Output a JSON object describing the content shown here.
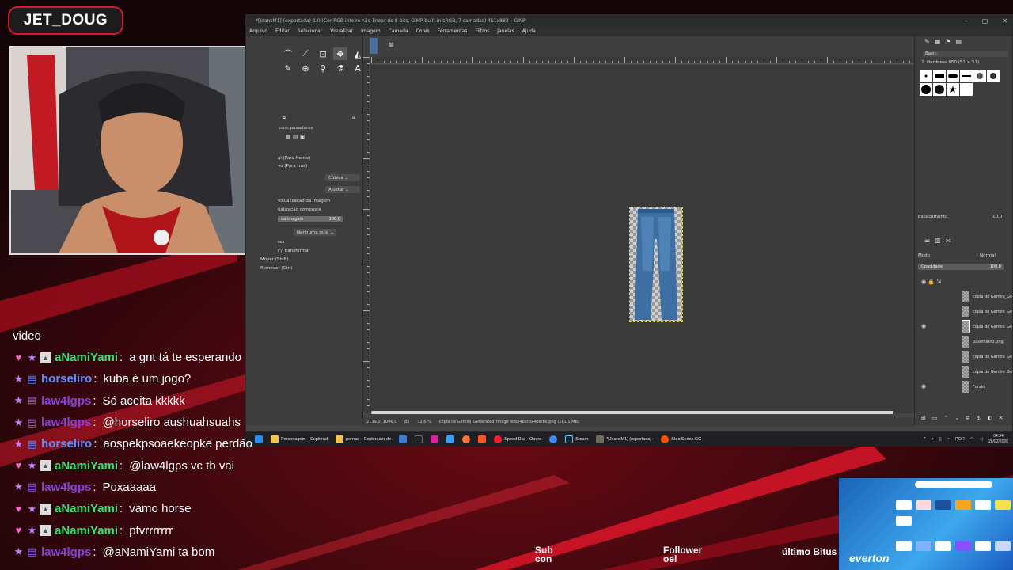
{
  "streamer": {
    "name": "JET_DOUG"
  },
  "gimp": {
    "title": "*[JeansM1] (exportada)-1.0 (Cor RGB inteiro não-linear de 8 bits, GIMP built-in sRGB, 7 camadas) 411x889 – GIMP",
    "menu": [
      "Arquivo",
      "Editar",
      "Selecionar",
      "Visualizar",
      "Imagem",
      "Camada",
      "Cores",
      "Ferramentas",
      "Filtros",
      "Janelas",
      "Ajuda"
    ],
    "tool_options": {
      "title": "com puxadores",
      "direction_1": "al (Para frente)",
      "direction_2": "vo (Para trás)",
      "interpolation": "Cúbica",
      "clipping": "Ajustar",
      "preview_1": "visualização da imagem",
      "preview_2": "ualização composta",
      "image_opacity_label": "da imagem",
      "image_opacity_value": "100,0",
      "guides": "Nenhuma guia",
      "guides_label": "res",
      "constraint": "r / Transformar",
      "move": "Mover (Shift)",
      "remove": "Remover (Ctrl)"
    },
    "status": {
      "coords": "2139,0, 1046,5",
      "unit": "px",
      "zoom": "32,6 %",
      "file": "cópia de Gemini_Generated_Image_erbx4berbx4berbx.png (161,1 MB)"
    },
    "brushes": {
      "preset": "Basic.",
      "brush_name": "2. Hardness 050 (51 × 51)",
      "spacing_label": "Espaçamento",
      "spacing_value": "10,0"
    },
    "layers_panel": {
      "mode_label": "Modo",
      "mode_value": "Normal",
      "opacity_label": "Opacidade",
      "opacity_value": "100,0",
      "layers": [
        "cópia de Gemini_Ge",
        "cópia de Gemini_Ge",
        "cópia de Gemini_Ge",
        "basemain3.png",
        "cópia de Gemini_Ge",
        "cópia de Gemini_Ge",
        "Fundo"
      ]
    }
  },
  "taskbar": {
    "items": [
      "Personagem – Explorad",
      "pernas – Explorador de",
      "Speed Dial - Opera",
      "Steam",
      "*[JeansM1] (exportada)-",
      "SteelSeries GG"
    ],
    "lang": "POR",
    "time": "04:34",
    "date": "28/02/2026"
  },
  "chat": {
    "header": "video",
    "messages": [
      {
        "user": "aNamiYami",
        "text": "a gnt tá te esperando",
        "color": "#39e070"
      },
      {
        "user": "horseliro",
        "text": "kuba é um jogo?",
        "color": "#5b8cff"
      },
      {
        "user": "law4lgps",
        "text": "Só aceita kkkkk",
        "color": "#8a3fd8"
      },
      {
        "user": "law4lgps",
        "text": "@horseliro aushuahsuahs",
        "color": "#8a3fd8"
      },
      {
        "user": "horseliro",
        "text": "aospekpsoaekeopke perdão",
        "color": "#5b8cff"
      },
      {
        "user": "aNamiYami",
        "text": "@law4lgps vc tb vai",
        "color": "#39e070"
      },
      {
        "user": "law4lgps",
        "text": "Poxaaaaa",
        "color": "#8a3fd8"
      },
      {
        "user": "aNamiYami",
        "text": "vamo horse",
        "color": "#39e070"
      },
      {
        "user": "aNamiYami",
        "text": "pfvrrrrrrr",
        "color": "#39e070"
      },
      {
        "user": "law4lgps",
        "text": "@aNamiYami ta bom",
        "color": "#8a3fd8"
      }
    ]
  },
  "ticker": {
    "sub": "Sub",
    "sub2": "con",
    "follower": "Follower",
    "follower2": "oel",
    "last_bits": "último Bitus",
    "overlay_name": "everton"
  }
}
